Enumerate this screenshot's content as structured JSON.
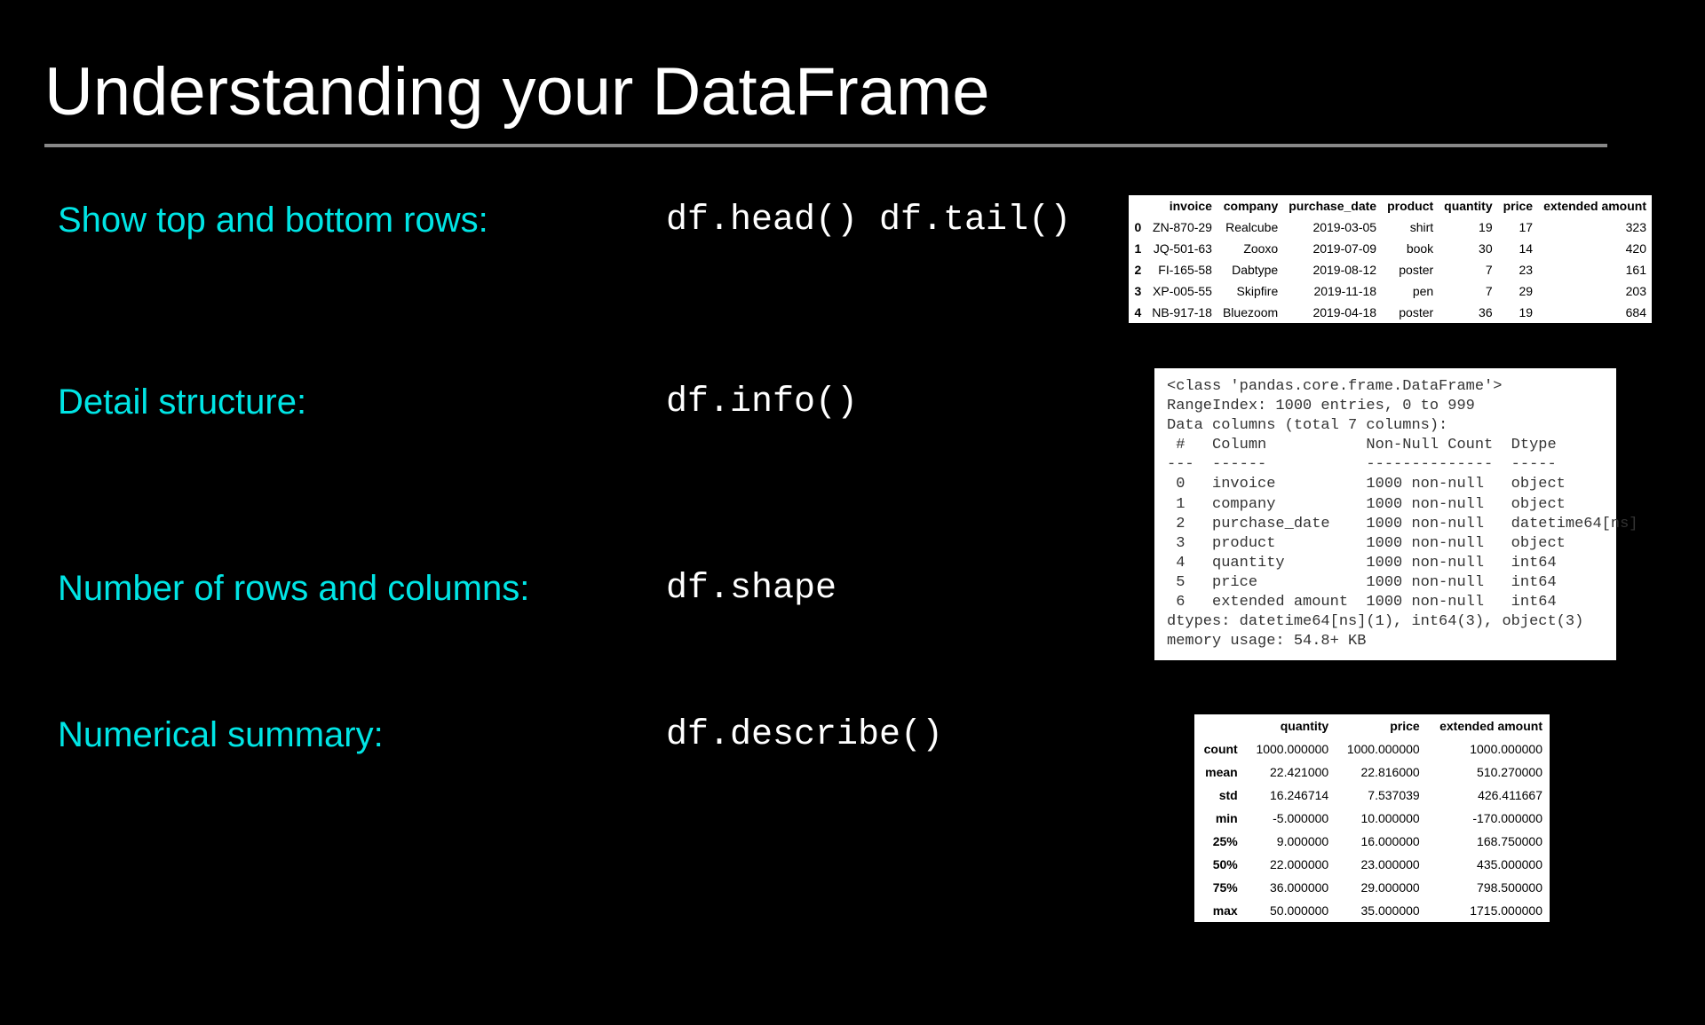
{
  "title": "Understanding your DataFrame",
  "rows": [
    {
      "label": "Show top and bottom rows:",
      "code": "df.head() df.tail()"
    },
    {
      "label": "Detail structure:",
      "code": "df.info()"
    },
    {
      "label": "Number of rows and columns:",
      "code": "df.shape"
    },
    {
      "label": "Numerical summary:",
      "code": "df.describe()"
    }
  ],
  "head_table": {
    "headers": [
      "",
      "invoice",
      "company",
      "purchase_date",
      "product",
      "quantity",
      "price",
      "extended amount"
    ],
    "data": [
      [
        "0",
        "ZN-870-29",
        "Realcube",
        "2019-03-05",
        "shirt",
        "19",
        "17",
        "323"
      ],
      [
        "1",
        "JQ-501-63",
        "Zooxo",
        "2019-07-09",
        "book",
        "30",
        "14",
        "420"
      ],
      [
        "2",
        "FI-165-58",
        "Dabtype",
        "2019-08-12",
        "poster",
        "7",
        "23",
        "161"
      ],
      [
        "3",
        "XP-005-55",
        "Skipfire",
        "2019-11-18",
        "pen",
        "7",
        "29",
        "203"
      ],
      [
        "4",
        "NB-917-18",
        "Bluezoom",
        "2019-04-18",
        "poster",
        "36",
        "19",
        "684"
      ]
    ]
  },
  "info_text": "<class 'pandas.core.frame.DataFrame'>\nRangeIndex: 1000 entries, 0 to 999\nData columns (total 7 columns):\n #   Column           Non-Null Count  Dtype\n---  ------           --------------  -----\n 0   invoice          1000 non-null   object\n 1   company          1000 non-null   object\n 2   purchase_date    1000 non-null   datetime64[ns]\n 3   product          1000 non-null   object\n 4   quantity         1000 non-null   int64\n 5   price            1000 non-null   int64\n 6   extended amount  1000 non-null   int64\ndtypes: datetime64[ns](1), int64(3), object(3)\nmemory usage: 54.8+ KB",
  "describe_table": {
    "headers": [
      "",
      "quantity",
      "price",
      "extended amount"
    ],
    "data": [
      [
        "count",
        "1000.000000",
        "1000.000000",
        "1000.000000"
      ],
      [
        "mean",
        "22.421000",
        "22.816000",
        "510.270000"
      ],
      [
        "std",
        "16.246714",
        "7.537039",
        "426.411667"
      ],
      [
        "min",
        "-5.000000",
        "10.000000",
        "-170.000000"
      ],
      [
        "25%",
        "9.000000",
        "16.000000",
        "168.750000"
      ],
      [
        "50%",
        "22.000000",
        "23.000000",
        "435.000000"
      ],
      [
        "75%",
        "36.000000",
        "29.000000",
        "798.500000"
      ],
      [
        "max",
        "50.000000",
        "35.000000",
        "1715.000000"
      ]
    ]
  }
}
